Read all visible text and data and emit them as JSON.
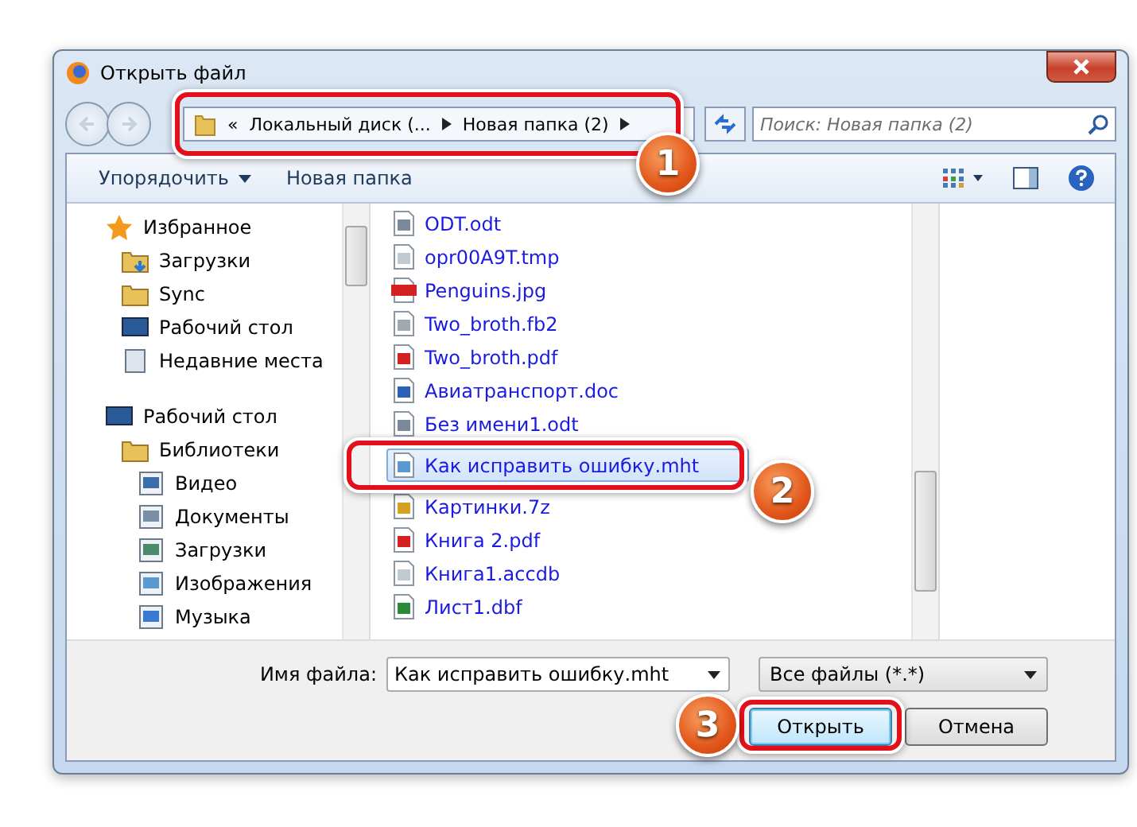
{
  "window": {
    "title": "Открыть файл"
  },
  "address_bar": {
    "overflow": "«",
    "segments": [
      "Локальный диск (...",
      "Новая папка (2)"
    ]
  },
  "search": {
    "placeholder": "Поиск: Новая папка (2)"
  },
  "toolbar": {
    "buttons": [
      {
        "label": "Упорядочить",
        "dropdown": true
      },
      {
        "label": "Новая папка",
        "dropdown": false
      }
    ]
  },
  "sidebar": {
    "groups": [
      {
        "label": "Избранное",
        "kind": "star",
        "children": [
          {
            "label": "Загрузки",
            "kind": "downloads"
          },
          {
            "label": "Sync",
            "kind": "folder"
          },
          {
            "label": "Рабочий стол",
            "kind": "desktop"
          },
          {
            "label": "Недавние места",
            "kind": "recent"
          }
        ]
      },
      {
        "label": "Рабочий стол",
        "kind": "desktop",
        "children": [
          {
            "label": "Библиотеки",
            "kind": "library",
            "children": [
              {
                "label": "Видео",
                "kind": "video"
              },
              {
                "label": "Документы",
                "kind": "document"
              },
              {
                "label": "Загрузки",
                "kind": "window"
              },
              {
                "label": "Изображения",
                "kind": "image"
              },
              {
                "label": "Музыка",
                "kind": "music"
              }
            ]
          }
        ]
      }
    ]
  },
  "files": [
    {
      "name": "ODT.odt",
      "kind": "odt",
      "selected": false
    },
    {
      "name": "opr00A9T.tmp",
      "kind": "blank",
      "selected": false
    },
    {
      "name": "Penguins.jpg",
      "kind": "jpg",
      "selected": false
    },
    {
      "name": "Two_broth.fb2",
      "kind": "text",
      "selected": false
    },
    {
      "name": "Two_broth.pdf",
      "kind": "pdf",
      "selected": false
    },
    {
      "name": "Авиатранспорт.doc",
      "kind": "doc",
      "selected": false
    },
    {
      "name": "Без имени1.odt",
      "kind": "odt",
      "selected": false
    },
    {
      "name": "Как исправить ошибку.mht",
      "kind": "web",
      "selected": true
    },
    {
      "name": "Картинки.7z",
      "kind": "archive",
      "selected": false
    },
    {
      "name": "Книга 2.pdf",
      "kind": "pdf",
      "selected": false
    },
    {
      "name": "Книга1.accdb",
      "kind": "blank",
      "selected": false
    },
    {
      "name": "Лист1.dbf",
      "kind": "sheet",
      "selected": false
    }
  ],
  "file_name": {
    "label": "Имя файла:",
    "value": "Как исправить ошибку.mht"
  },
  "file_type": {
    "value": "Все файлы (*.*)"
  },
  "buttons": [
    {
      "label": "Открыть",
      "default": true
    },
    {
      "label": "Отмена",
      "default": false
    }
  ],
  "callouts": [
    {
      "number": "1"
    },
    {
      "number": "2"
    },
    {
      "number": "3"
    }
  ]
}
